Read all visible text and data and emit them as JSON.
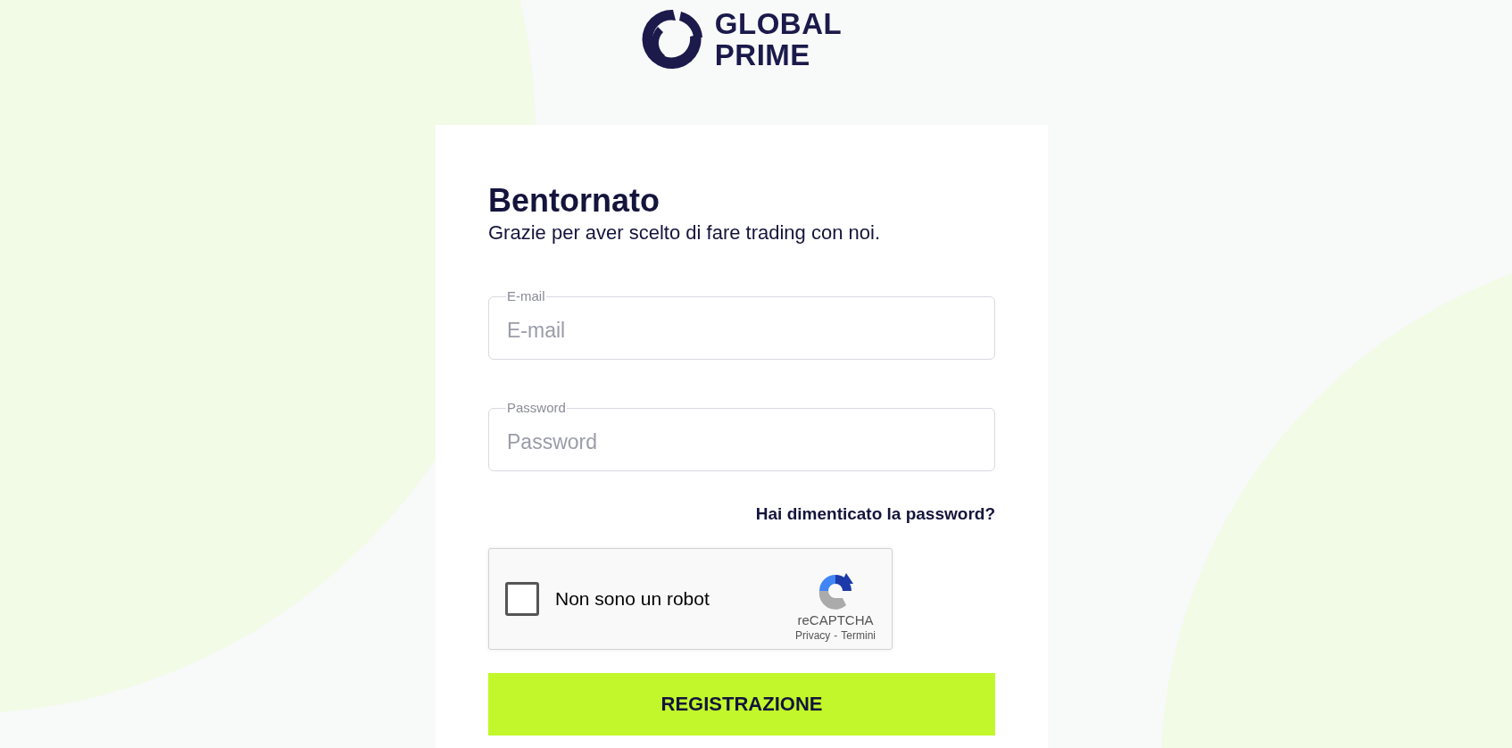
{
  "logo": {
    "lines": [
      "GLOBAL",
      "PRIME"
    ]
  },
  "login": {
    "title": "Bentornato",
    "subtitle": "Grazie per aver scelto di fare trading con noi.",
    "fields": [
      {
        "label": "E-mail",
        "placeholder": "E-mail"
      },
      {
        "label": "Password",
        "placeholder": "Password"
      }
    ],
    "forgot_link": "Hai dimenticato la password?",
    "captcha": {
      "label": "Non sono un robot",
      "checked": false,
      "brand": "reCAPTCHA",
      "links": [
        "Privacy",
        "Termini"
      ],
      "separator": "-"
    },
    "submit": "REGISTRAZIONE"
  }
}
